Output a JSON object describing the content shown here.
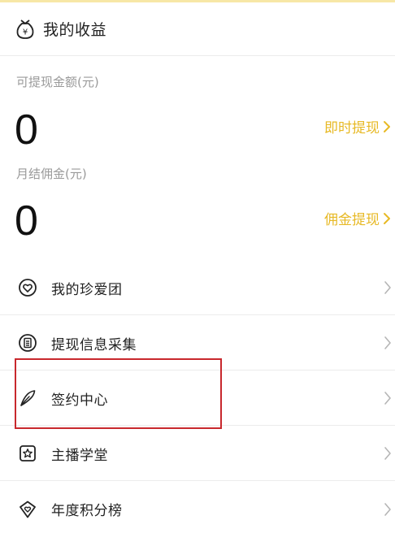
{
  "header": {
    "icon": "money-bag-icon",
    "title": "我的收益"
  },
  "withdrawable": {
    "label": "可提现金额(元)",
    "value": "0",
    "action_label": "即时提现"
  },
  "monthly_commission": {
    "label": "月结佣金(元)",
    "value": "0",
    "action_label": "佣金提现"
  },
  "menu": {
    "items": [
      {
        "label": "我的珍爱团",
        "icon": "heart-circle-icon"
      },
      {
        "label": "提现信息采集",
        "icon": "document-circle-icon"
      },
      {
        "label": "签约中心",
        "icon": "feather-icon"
      },
      {
        "label": "主播学堂",
        "icon": "star-badge-icon"
      },
      {
        "label": "年度积分榜",
        "icon": "heart-diamond-icon"
      }
    ]
  },
  "colors": {
    "accent": "#e7b925",
    "highlight": "#c8282d",
    "divider": "#ececec"
  }
}
